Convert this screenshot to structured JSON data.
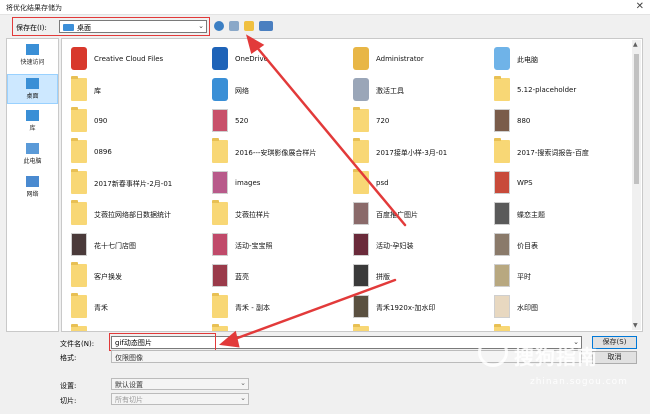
{
  "window": {
    "title": "将优化结果存储为",
    "close_glyph": "✕"
  },
  "toolbar": {
    "save_in_label": "保存在(I):",
    "location": "桌面",
    "icons": [
      "back-icon",
      "up-folder-icon",
      "new-folder-icon",
      "view-menu-icon"
    ]
  },
  "sidebar": {
    "items": [
      {
        "label": "快速访问",
        "icon": "star-icon",
        "selected": false
      },
      {
        "label": "桌面",
        "icon": "desktop-icon",
        "selected": true
      },
      {
        "label": "库",
        "icon": "library-icon",
        "selected": false
      },
      {
        "label": "此电脑",
        "icon": "computer-icon",
        "selected": false
      },
      {
        "label": "网络",
        "icon": "network-icon",
        "selected": false
      }
    ]
  },
  "files": [
    {
      "name": "Creative Cloud Files",
      "kind": "icon",
      "color": "#d8382c"
    },
    {
      "name": "OneDrive",
      "kind": "icon",
      "color": "#1e63b8"
    },
    {
      "name": "Administrator",
      "kind": "icon",
      "color": "#e8b646"
    },
    {
      "name": "此电脑",
      "kind": "icon",
      "color": "#6fb3e8"
    },
    {
      "name": "库",
      "kind": "folder",
      "color": "#f8d775"
    },
    {
      "name": "网络",
      "kind": "icon",
      "color": "#3a8fd6"
    },
    {
      "name": "激活工具",
      "kind": "icon",
      "color": "#9aa6b8"
    },
    {
      "name": "5.12-placeholder",
      "kind": "folder",
      "color": "#f8d775"
    },
    {
      "name": "090",
      "kind": "folder",
      "color": "#f8d775"
    },
    {
      "name": "520",
      "kind": "photo",
      "color": "#c8506a"
    },
    {
      "name": "720",
      "kind": "folder",
      "color": "#f8d775"
    },
    {
      "name": "880",
      "kind": "photo",
      "color": "#7a5c4a"
    },
    {
      "name": "0896",
      "kind": "folder",
      "color": "#f8d775"
    },
    {
      "name": "2016---安琪影像展合样片",
      "kind": "folder",
      "color": "#f8d775"
    },
    {
      "name": "2017接单小样-3月-01",
      "kind": "folder",
      "color": "#f8d775"
    },
    {
      "name": "2017-搜索词报告-百度",
      "kind": "folder",
      "color": "#f8d775"
    },
    {
      "name": "2017新春事样片-2月-01",
      "kind": "folder",
      "color": "#f8d775"
    },
    {
      "name": "images",
      "kind": "photo",
      "color": "#b85a8a"
    },
    {
      "name": "psd",
      "kind": "folder",
      "color": "#f8d775"
    },
    {
      "name": "WPS",
      "kind": "photo",
      "color": "#c84a3a"
    },
    {
      "name": "艾薇拉网络部日数据统计",
      "kind": "folder",
      "color": "#f8d775"
    },
    {
      "name": "艾薇拉样片",
      "kind": "folder",
      "color": "#f8d775"
    },
    {
      "name": "百度推广图片",
      "kind": "photo",
      "color": "#8a6a6a"
    },
    {
      "name": "蝶恋主题",
      "kind": "photo",
      "color": "#5a5a5a"
    },
    {
      "name": "花十七门店图",
      "kind": "photo",
      "color": "#4a3a3a"
    },
    {
      "name": "活动-宝宝照",
      "kind": "photo",
      "color": "#c04a6a"
    },
    {
      "name": "活动-孕妇装",
      "kind": "photo",
      "color": "#6a2a3a"
    },
    {
      "name": "价目表",
      "kind": "photo",
      "color": "#8a7a6a"
    },
    {
      "name": "客户换发",
      "kind": "folder",
      "color": "#f8d775"
    },
    {
      "name": "蓝亮",
      "kind": "photo",
      "color": "#9a3a4a"
    },
    {
      "name": "拼版",
      "kind": "photo",
      "color": "#3a3a3a"
    },
    {
      "name": "平时",
      "kind": "photo",
      "color": "#b8a880"
    },
    {
      "name": "青禾",
      "kind": "folder",
      "color": "#f8d775"
    },
    {
      "name": "青禾 - 副本",
      "kind": "folder",
      "color": "#f8d775"
    },
    {
      "name": "青禾1920x-加水印",
      "kind": "photo",
      "color": "#5a5040"
    },
    {
      "name": "水印图",
      "kind": "photo",
      "color": "#e8d8c0"
    },
    {
      "name": "",
      "kind": "folder",
      "color": "#f8d775"
    },
    {
      "name": "",
      "kind": "folder",
      "color": "#f8d775"
    },
    {
      "name": "",
      "kind": "folder",
      "color": "#f8d775"
    },
    {
      "name": "",
      "kind": "folder",
      "color": "#f8d775"
    }
  ],
  "filename": {
    "label": "文件名(N):",
    "value": "gif动态图片"
  },
  "format": {
    "label": "格式:",
    "value": "仅限图像"
  },
  "buttons": {
    "save": "保存(S)",
    "cancel": "取消"
  },
  "settings": {
    "label": "设置:",
    "value": "默认设置"
  },
  "slices": {
    "label": "切片:",
    "value": "所有切片"
  },
  "watermark": {
    "brand": "搜狗指南",
    "url": "zhinan.sogou.com"
  },
  "colors": {
    "accent": "#0078d7",
    "annotation": "#e23a3a",
    "selected_bg": "#cde8ff"
  }
}
